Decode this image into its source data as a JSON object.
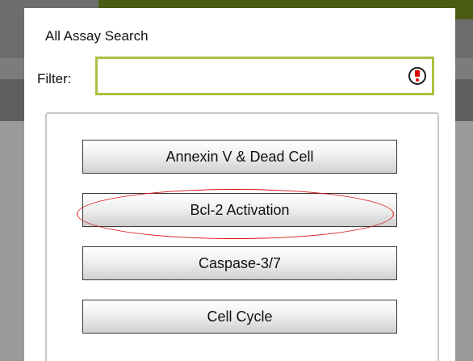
{
  "dialog": {
    "title": "All Assay Search"
  },
  "filter": {
    "label": "Filter:",
    "value": "",
    "placeholder": "",
    "status_icon": "alert-circle-icon",
    "border_color": "#a9c23f"
  },
  "assays": {
    "items": [
      {
        "label": "Annexin V & Dead Cell"
      },
      {
        "label": "Bcl-2 Activation"
      },
      {
        "label": "Caspase-3/7"
      },
      {
        "label": "Cell Cycle"
      }
    ],
    "highlighted": "Bcl-2 Activation",
    "highlight_color": "#dd1111"
  },
  "colors": {
    "header_green": "#4a5c14",
    "overlay_gray": "#8c8c8c"
  }
}
